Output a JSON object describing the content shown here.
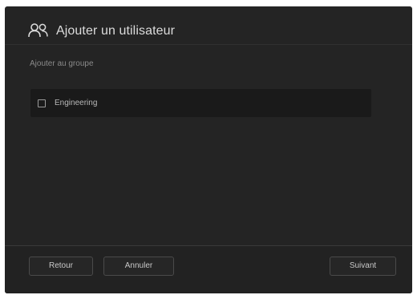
{
  "dialog": {
    "title": "Ajouter un utilisateur",
    "icon": "users-icon",
    "section_label": "Ajouter au groupe",
    "groups": [
      {
        "label": "Engineering",
        "checked": false
      }
    ]
  },
  "footer": {
    "back_label": "Retour",
    "cancel_label": "Annuler",
    "next_label": "Suivant"
  }
}
